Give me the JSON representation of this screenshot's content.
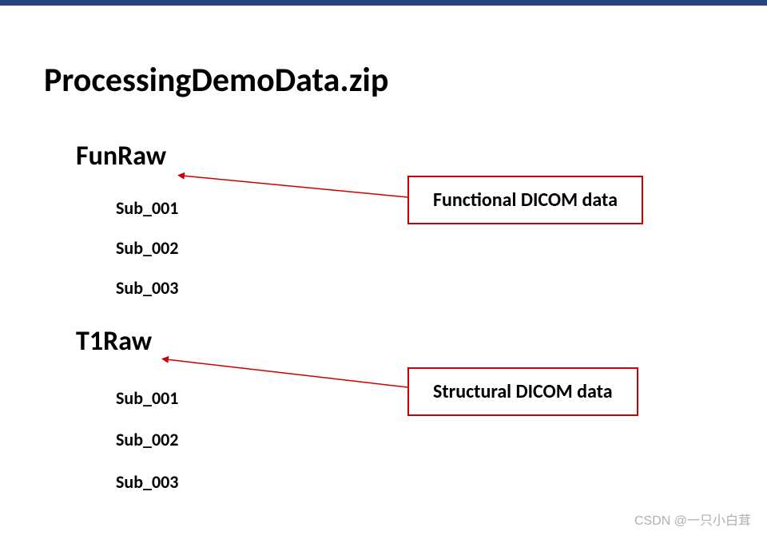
{
  "title": "ProcessingDemoData.zip",
  "sections": {
    "funraw": {
      "heading": "FunRaw",
      "items": [
        "Sub_001",
        "Sub_002",
        "Sub_003"
      ]
    },
    "t1raw": {
      "heading": "T1Raw",
      "items": [
        "Sub_001",
        "Sub_002",
        "Sub_003"
      ]
    }
  },
  "annotations": {
    "functional": "Functional DICOM data",
    "structural": "Structural DICOM data"
  },
  "watermark": "CSDN @一只小白茸",
  "colors": {
    "topBorder": "#2a4580",
    "annotationBorder": "#cc0000",
    "arrow": "#cc0000"
  }
}
